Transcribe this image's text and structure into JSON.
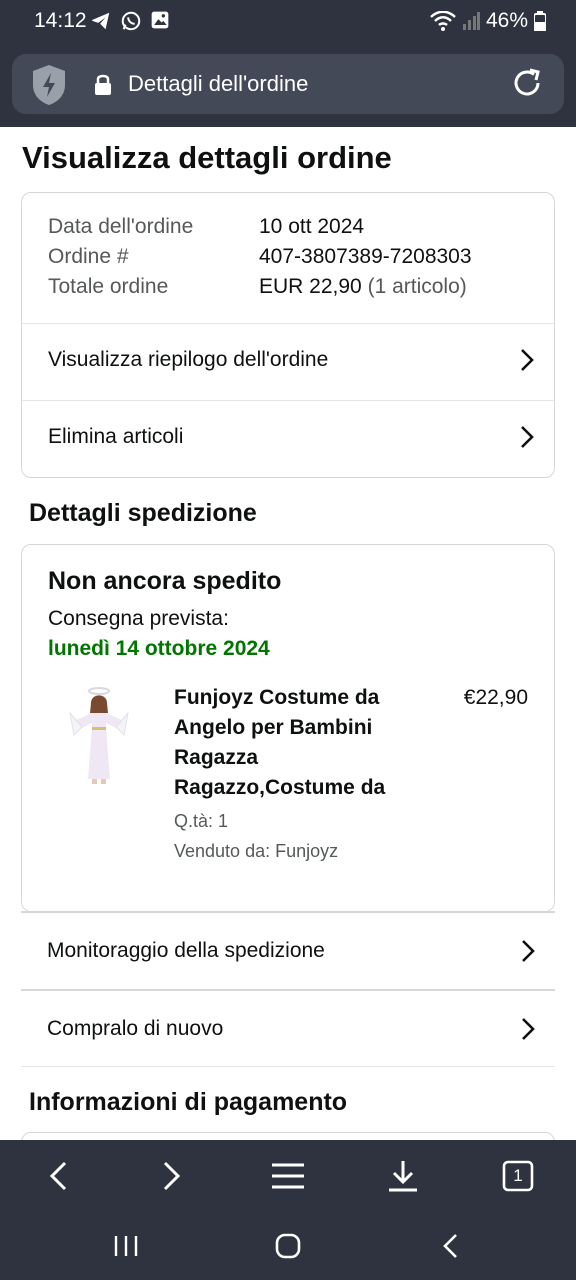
{
  "status": {
    "time": "14:12",
    "battery": "46%"
  },
  "browser": {
    "url_text": "Dettagli dell'ordine",
    "tab_count": "1"
  },
  "page": {
    "title": "Visualizza dettagli ordine",
    "order": {
      "date_label": "Data dell'ordine",
      "date_value": "10 ott 2024",
      "number_label": "Ordine #",
      "number_value": "407-3807389-7208303",
      "total_label": "Totale ordine",
      "total_value": "EUR 22,90",
      "total_items": "(1 articolo)"
    },
    "order_links": [
      {
        "label": "Visualizza riepilogo dell'ordine"
      },
      {
        "label": "Elimina articoli"
      }
    ],
    "shipping": {
      "heading": "Dettagli spedizione",
      "status": "Non ancora spedito",
      "delivery_label": "Consegna prevista:",
      "delivery_date": "lunedì 14 ottobre 2024",
      "item": {
        "title": "Funjoyz Costume da Angelo per Bambini Ragazza Ragazzo,Costume da",
        "price": "€22,90",
        "qty": "Q.tà: 1",
        "seller": "Venduto da: Funjoyz"
      },
      "links": [
        {
          "label": "Monitoraggio della spedizione"
        },
        {
          "label": "Compralo di nuovo"
        }
      ]
    },
    "payment": {
      "heading": "Informazioni di pagamento"
    }
  },
  "icons": {
    "status": [
      "telegram-icon",
      "whatsapp-icon",
      "gallery-icon",
      "wifi-icon",
      "signal-icon",
      "battery-icon"
    ],
    "browser": [
      "shield-icon",
      "lock-icon",
      "reload-icon",
      "back-icon",
      "forward-icon",
      "menu-icon",
      "download-icon",
      "tabs-icon"
    ],
    "system": [
      "recents-icon",
      "home-icon",
      "system-back-icon"
    ]
  },
  "colors": {
    "bar": "#2f3340",
    "urlbar": "#444958",
    "delivery_green": "#007600",
    "border": "#d5d9d9"
  }
}
